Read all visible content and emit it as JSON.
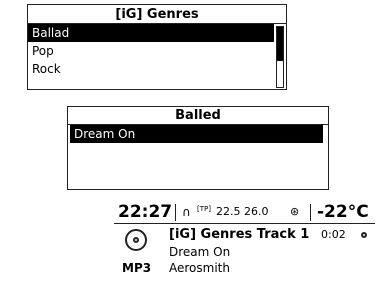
{
  "genres_screen": {
    "title": "[iG] Genres",
    "items": [
      "Ballad",
      "Pop",
      "Rock"
    ],
    "selected": "Ballad"
  },
  "ballad_screen": {
    "title": "Balled",
    "items": [
      "Dream On"
    ],
    "selected": "Dream On"
  },
  "now_playing": {
    "clock": "22:27",
    "headphone_icon": "headphone-icon",
    "tp_label": "[TP]",
    "temperatures": "22.5 26.0",
    "bluetooth_icon": "bluetooth-icon",
    "outside_temp": "-22°C",
    "media_icon": "disc-icon",
    "format": "MP3",
    "track_title": "[iG] Genres Track 1",
    "elapsed": "0:02",
    "song": "Dream On",
    "artist": "Aerosmith"
  }
}
